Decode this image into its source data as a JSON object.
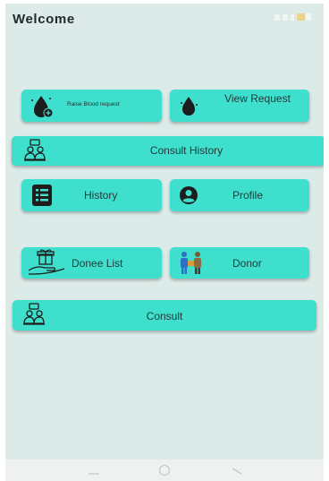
{
  "header": {
    "title": "Welcome"
  },
  "status_bar": {
    "icons": [
      "signal-icon",
      "wifi-icon",
      "nfc-icon",
      "battery-icon"
    ]
  },
  "menu": {
    "raise_blood_request": {
      "label": "Raise Blood request",
      "icon": "blood-drop-plus-icon"
    },
    "view_request": {
      "label": "View Request",
      "icon": "blood-drop-icon"
    },
    "consult_history": {
      "label": "Consult History",
      "icon": "doctor-consult-icon"
    },
    "history": {
      "label": "History",
      "icon": "list-document-icon"
    },
    "profile": {
      "label": "Profile",
      "icon": "user-profile-icon"
    },
    "donee_list": {
      "label": "Donee List",
      "icon": "gift-hand-icon"
    },
    "donor": {
      "label": "Donor",
      "icon": "donor-people-icon"
    },
    "consult": {
      "label": "Consult",
      "icon": "doctor-consult-icon"
    }
  },
  "nav_bar": {
    "keys": [
      "back-icon",
      "home-icon",
      "recents-icon"
    ]
  },
  "colors": {
    "background": "#dcebe8",
    "button": "#3ee0cd",
    "text": "#233a3a"
  }
}
